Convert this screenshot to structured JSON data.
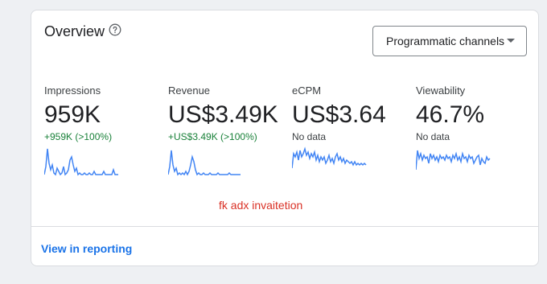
{
  "card": {
    "title": "Overview",
    "help_icon": "help-circle-icon",
    "dropdown": {
      "selected": "Programmatic channels",
      "icon": "caret-down-icon"
    },
    "footer_link": "View in reporting",
    "annotation": "fk adx invaitetion"
  },
  "metrics": [
    {
      "label": "Impressions",
      "value": "959K",
      "change": "+959K (>100%)"
    },
    {
      "label": "Revenue",
      "value": "US$3.49K",
      "change": "+US$3.49K (>100%)"
    },
    {
      "label": "eCPM",
      "value": "US$3.64",
      "change": "No data"
    },
    {
      "label": "Viewability",
      "value": "46.7%",
      "change": "No data"
    }
  ],
  "colors": {
    "accent": "#1a73e8",
    "positive": "#188038",
    "annotation": "#d93025",
    "sparkline": "#4285f4"
  }
}
